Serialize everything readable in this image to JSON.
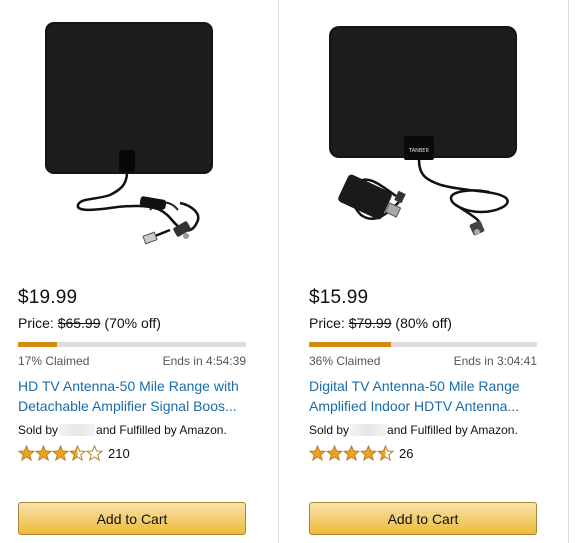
{
  "products": [
    {
      "price": "$19.99",
      "price_label": "Price:",
      "list_price": "$65.99",
      "discount": "(70% off)",
      "claimed": "17% Claimed",
      "claimed_fraction": 0.17,
      "ends": "Ends in 4:54:39",
      "title_line1": "HD TV Antenna-50 Mile Range with",
      "title_line2": "Detachable Amplifier Signal Boos...",
      "sold_prefix": "Sold by",
      "sold_suffix": "and Fulfilled by Amazon.",
      "rating": 3.5,
      "review_count": "210",
      "cart_label": "Add to Cart"
    },
    {
      "price": "$15.99",
      "price_label": "Price:",
      "list_price": "$79.99",
      "discount": "(80% off)",
      "claimed": "36% Claimed",
      "claimed_fraction": 0.36,
      "ends": "Ends in 3:04:41",
      "title_line1": "Digital TV Antenna-50 Mile Range",
      "title_line2": "Amplified Indoor HDTV Antenna...",
      "sold_prefix": "Sold by",
      "sold_suffix": "and Fulfilled by Amazon.",
      "rating": 4.5,
      "review_count": "26",
      "cart_label": "Add to Cart",
      "device_logo": "TANBER"
    }
  ],
  "colors": {
    "link": "#1a6ca8",
    "progress": "#d48a11",
    "star": "#f0a21e",
    "button_top": "#f8e3ad",
    "button_bottom": "#eeba37"
  }
}
